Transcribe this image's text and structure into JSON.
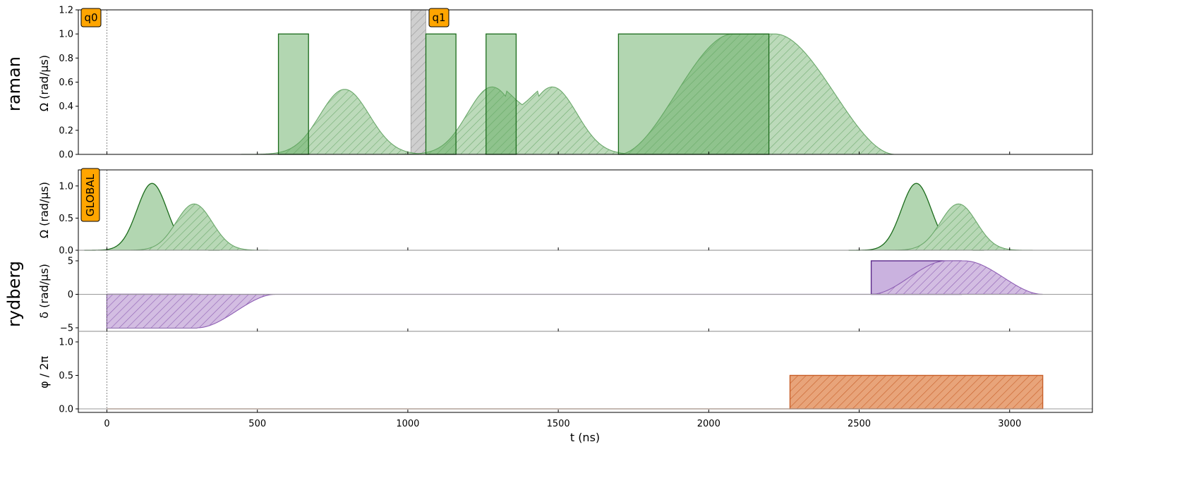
{
  "chart_data": {
    "type": "area",
    "xlabel": "t (ns)",
    "xlim": [
      -95,
      3275
    ],
    "xticks": [
      0,
      500,
      1000,
      1500,
      2000,
      2500,
      3000
    ],
    "total_duration": 3110,
    "colors": {
      "amplitude_fill": "#b2d4b0",
      "amplitude_line": "#1b6b1b",
      "amplitude_hatch": "#6aa86a",
      "detuning_fill": "#c8aed8",
      "detuning_line": "#5c2a8a",
      "detuning_hatch": "#8e5fb4",
      "phase_fill": "#e8a47a",
      "phase_line": "#c8602a",
      "target_fill": "#cccccc",
      "target_line": "#888888",
      "tag_fill": "#ffa500"
    },
    "panels": [
      {
        "channel_label": "raman",
        "ylabel": "Ω (rad/µs)",
        "ylim": [
          0,
          1.2
        ],
        "yticks": [
          "0.0",
          "0.2",
          "0.4",
          "0.6",
          "0.8",
          "1.0",
          "1.2"
        ],
        "target_tags": [
          {
            "label": "q0",
            "t": 0
          },
          {
            "label": "q1",
            "t": 1010,
            "region": [
              1010,
              1060
            ]
          }
        ],
        "square_pulses": [
          {
            "start": 570,
            "end": 670,
            "value": 1.0
          },
          {
            "start": 1060,
            "end": 1160,
            "value": 1.0
          },
          {
            "start": 1260,
            "end": 1360,
            "value": 1.0
          },
          {
            "start": 1700,
            "end": 2200,
            "value": 1.0
          }
        ],
        "modulated_pulses": [
          {
            "type": "gaussian",
            "center": 790,
            "sigma": 82,
            "peak": 0.54
          },
          {
            "type": "gaussian_sum",
            "centers": [
              1280,
              1480
            ],
            "sigma": 82,
            "peak": 0.56
          },
          {
            "type": "smooth_plateau",
            "rise_start": 1700,
            "rise_end": 2080,
            "fall_start": 2220,
            "fall_end": 2620,
            "peak": 1.0
          }
        ]
      },
      {
        "channel_label": "rydberg",
        "tag": "GLOBAL",
        "sub_panels": [
          {
            "quantity": "amplitude",
            "ylabel": "Ω (rad/µs)",
            "ylim": [
              0,
              1.25
            ],
            "yticks": [
              "0.0",
              "0.5",
              "1.0"
            ],
            "pulses": [
              {
                "type": "gaussian",
                "center": 150,
                "sigma": 50,
                "peak": 1.04,
                "style": "solid"
              },
              {
                "type": "gaussian",
                "center": 290,
                "sigma": 60,
                "peak": 0.72,
                "style": "hatched"
              },
              {
                "type": "gaussian",
                "center": 2690,
                "sigma": 50,
                "peak": 1.04,
                "style": "solid"
              },
              {
                "type": "gaussian",
                "center": 2830,
                "sigma": 60,
                "peak": 0.72,
                "style": "hatched"
              }
            ]
          },
          {
            "quantity": "detuning",
            "ylabel": "δ (rad/µs)",
            "ylim": [
              -5.5,
              5.5
            ],
            "yticks": [
              "−5",
              "0",
              "5"
            ],
            "tickvals": [
              -5,
              0,
              5
            ],
            "pulses": [
              {
                "type": "square",
                "start": 0,
                "end": 300,
                "value": -5.0,
                "style": "solid"
              },
              {
                "type": "smooth_step",
                "plateau_start": 0,
                "plateau_end": 300,
                "decay_end": 560,
                "value": -5.0,
                "style": "hatched"
              },
              {
                "type": "square",
                "start": 2540,
                "end": 2840,
                "value": 5.0,
                "style": "solid"
              },
              {
                "type": "smooth_plateau",
                "rise_start": 2540,
                "rise_end": 2790,
                "fall_start": 2850,
                "fall_end": 3110,
                "value": 5.0,
                "style": "hatched"
              }
            ]
          },
          {
            "quantity": "phase",
            "ylabel": "φ / 2π",
            "ylim": [
              -0.05,
              1.12
            ],
            "yticks": [
              "0.0",
              "0.5",
              "1.0"
            ],
            "tickvals": [
              0,
              0.5,
              1.0
            ],
            "pulses": [
              {
                "type": "square",
                "start": 2270,
                "end": 3110,
                "value": 0.5
              }
            ]
          }
        ]
      }
    ]
  }
}
